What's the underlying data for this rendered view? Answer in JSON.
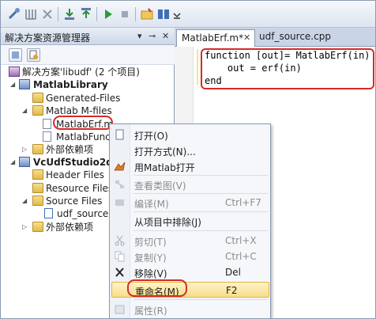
{
  "editor": {
    "tabs": [
      {
        "label": "MatlabErf.m*",
        "active": true
      },
      {
        "label": "udf_source.cpp",
        "active": false
      }
    ],
    "code": [
      "function [out]= MatlabErf(in)",
      "    out = erf(in)",
      "end"
    ]
  },
  "solution_explorer": {
    "title": "解决方案资源管理器",
    "header_icons": [
      "pin-icon",
      "close-icon"
    ],
    "tree": [
      {
        "label": "解决方案'libudf' (2 个项目)",
        "icon": "solution-icon"
      },
      {
        "label": "MatlabLibrary",
        "icon": "project-icon",
        "bold": true
      },
      {
        "label": "Generated-Files",
        "icon": "folder-icon"
      },
      {
        "label": "Matlab M-files",
        "icon": "folder-icon"
      },
      {
        "label": "MatlabErf.m",
        "icon": "file-icon",
        "selected": true
      },
      {
        "label": "MatlabFunct",
        "icon": "file-icon"
      },
      {
        "label": "外部依赖项",
        "icon": "folder-icon"
      },
      {
        "label": "VcUdfStudio2d_s",
        "icon": "project-icon",
        "bold": true
      },
      {
        "label": "Header Files",
        "icon": "folder-icon"
      },
      {
        "label": "Resource Files",
        "icon": "folder-icon"
      },
      {
        "label": "Source Files",
        "icon": "folder-icon"
      },
      {
        "label": "udf_source.c",
        "icon": "cpp-file-icon"
      },
      {
        "label": "外部依赖项",
        "icon": "folder-icon"
      }
    ]
  },
  "context_menu": {
    "items": [
      {
        "label": "打开(O)",
        "shortcut": "",
        "icon": "open-icon",
        "disabled": false
      },
      {
        "label": "打开方式(N)...",
        "shortcut": "",
        "icon": "",
        "disabled": false
      },
      {
        "label": "用Matlab打开",
        "shortcut": "",
        "icon": "matlab-icon",
        "disabled": false
      },
      {
        "label": "查看类图(V)",
        "shortcut": "",
        "icon": "class-diagram-icon",
        "disabled": true
      },
      {
        "label": "编译(M)",
        "shortcut": "Ctrl+F7",
        "icon": "compile-icon",
        "disabled": true
      },
      {
        "label": "从项目中排除(J)",
        "shortcut": "",
        "icon": "",
        "disabled": false
      },
      {
        "label": "剪切(T)",
        "shortcut": "Ctrl+X",
        "icon": "cut-icon",
        "disabled": true
      },
      {
        "label": "复制(Y)",
        "shortcut": "Ctrl+C",
        "icon": "copy-icon",
        "disabled": true
      },
      {
        "label": "移除(V)",
        "shortcut": "Del",
        "icon": "remove-icon",
        "disabled": false
      },
      {
        "label": "重命名(M)",
        "shortcut": "F2",
        "icon": "",
        "disabled": false,
        "highlighted": true
      },
      {
        "label": "属性(R)",
        "shortcut": "",
        "icon": "properties-icon",
        "disabled": true
      }
    ]
  },
  "colors": {
    "annotation_red": "#d42a2a",
    "highlight": "#f8dd8a"
  }
}
